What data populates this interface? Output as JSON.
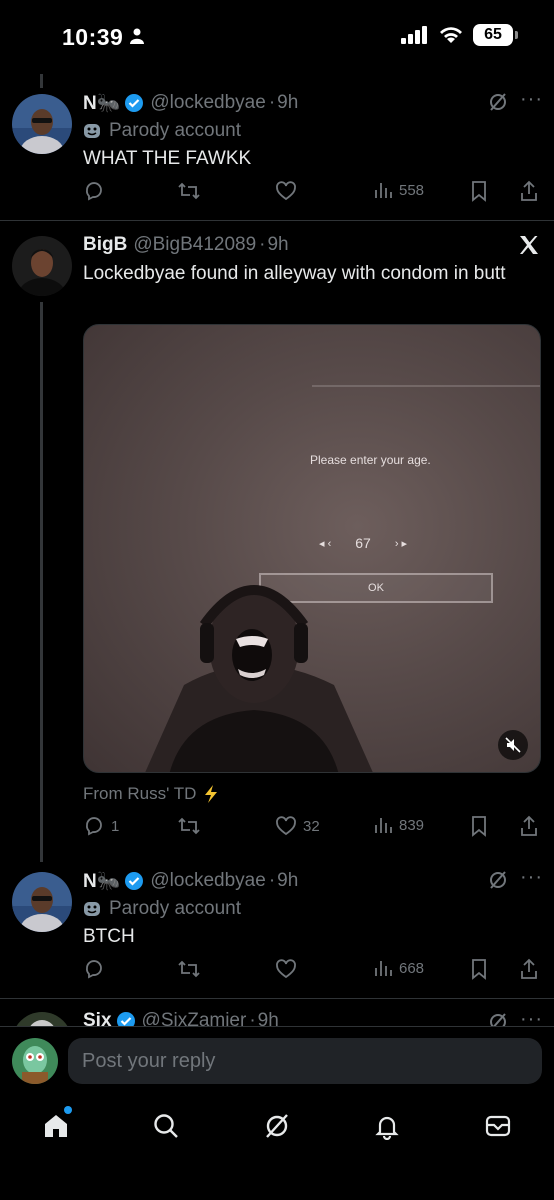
{
  "status_bar": {
    "time": "10:39",
    "battery": "65"
  },
  "tweets": [
    {
      "name": "N🐜",
      "handle": "@lockedbyae",
      "time": "9h",
      "parody": "Parody account",
      "text": "WHAT THE FAWKK",
      "replies": "",
      "likes": "",
      "views": "558"
    },
    {
      "name": "BigB",
      "handle": "@BigB412089",
      "time": "9h",
      "text": "Lockedbyae found in alleyway with condom in butt",
      "media": {
        "prompt": "Please enter your age.",
        "age": "67",
        "ok": "OK"
      },
      "source": "From Russ' TD",
      "replies": "1",
      "likes": "32",
      "views": "839"
    },
    {
      "name": "N🐜",
      "handle": "@lockedbyae",
      "time": "9h",
      "parody": "Parody account",
      "text": "BTCH",
      "replies": "",
      "likes": "",
      "views": "668"
    },
    {
      "name": "Six",
      "handle": "@SixZamier",
      "time": "9h"
    }
  ],
  "reply": {
    "placeholder": "Post your reply"
  },
  "tabs": [
    "home-icon",
    "search-icon",
    "grok-icon",
    "notifications-icon",
    "messages-icon"
  ],
  "colors": {
    "accent": "#1d9bf0",
    "muted": "#71767b",
    "text": "#e7e9ea",
    "divider": "#2f3336"
  }
}
